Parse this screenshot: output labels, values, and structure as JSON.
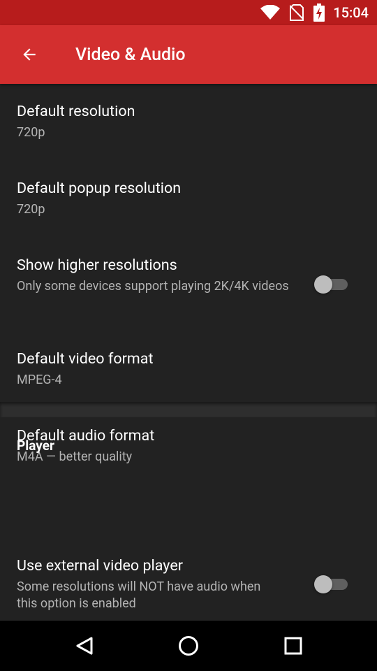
{
  "status_bar": {
    "time": "15:04",
    "icons": [
      "wifi-icon",
      "no-sim-icon",
      "battery-charging-icon"
    ]
  },
  "app_bar": {
    "title": "Video & Audio",
    "back_icon": "arrow-back-icon"
  },
  "preferences": [
    {
      "title": "Default resolution",
      "summary": "720p"
    },
    {
      "title": "Default popup resolution",
      "summary": "720p"
    },
    {
      "title": "Show higher resolutions",
      "summary": "Only some devices support playing 2K/4K videos",
      "switch": false
    },
    {
      "title": "Default video format",
      "summary": "MPEG-4"
    },
    {
      "title": "Default audio format",
      "summary": "M4A — better quality"
    }
  ],
  "player_category": {
    "title": "Player",
    "items": [
      {
        "title": "Use external video player",
        "summary": "Some resolutions will NOT have audio when this option is enabled",
        "switch": false
      }
    ]
  },
  "nav_bar": {
    "icons": [
      "back-triangle-icon",
      "home-circle-icon",
      "recents-square-icon"
    ]
  },
  "colors": {
    "status_bar": "#b71c1c",
    "app_bar": "#d32f2f",
    "background": "#222222"
  }
}
